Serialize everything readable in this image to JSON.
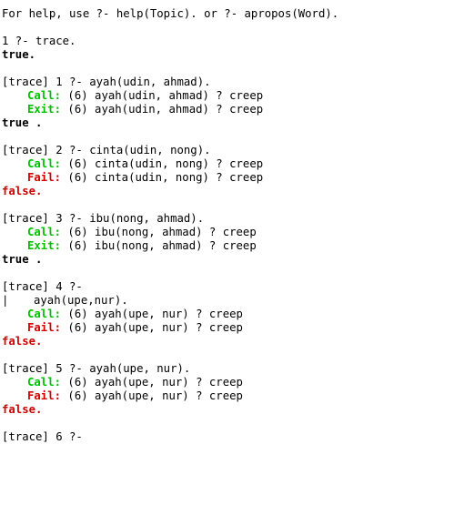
{
  "help_line": "For help, use ?- help(Topic). or ?- apropos(Word).",
  "q1": {
    "prompt": "1 ?- trace.",
    "result": "true."
  },
  "q2": {
    "prompt": "[trace] 1 ?- ayah(udin, ahmad).",
    "port1": "Call:",
    "goal1": " (6) ayah(udin, ahmad) ? creep",
    "port2": "Exit:",
    "goal2": " (6) ayah(udin, ahmad) ? creep",
    "result": "true ."
  },
  "q3": {
    "prompt": "[trace] 2 ?- cinta(udin, nong).",
    "port1": "Call:",
    "goal1": " (6) cinta(udin, nong) ? creep",
    "port2": "Fail:",
    "goal2": " (6) cinta(udin, nong) ? creep",
    "result": "false."
  },
  "q4": {
    "prompt": "[trace] 3 ?- ibu(nong, ahmad).",
    "port1": "Call:",
    "goal1": " (6) ibu(nong, ahmad) ? creep",
    "port2": "Exit:",
    "goal2": " (6) ibu(nong, ahmad) ? creep",
    "result": "true ."
  },
  "q5": {
    "prompt": "[trace] 4 ?-",
    "continuation_bar": "|",
    "continuation": "ayah(upe,nur).",
    "port1": "Call:",
    "goal1": " (6) ayah(upe, nur) ? creep",
    "port2": "Fail:",
    "goal2": " (6) ayah(upe, nur) ? creep",
    "result": "false."
  },
  "q6": {
    "prompt": "[trace] 5 ?- ayah(upe, nur).",
    "port1": "Call:",
    "goal1": " (6) ayah(upe, nur) ? creep",
    "port2": "Fail:",
    "goal2": " (6) ayah(upe, nur) ? creep",
    "result": "false."
  },
  "q7": {
    "prompt": "[trace] 6 ?-"
  },
  "colors": {
    "call_exit": "#00c000",
    "fail_false": "#d00000"
  }
}
